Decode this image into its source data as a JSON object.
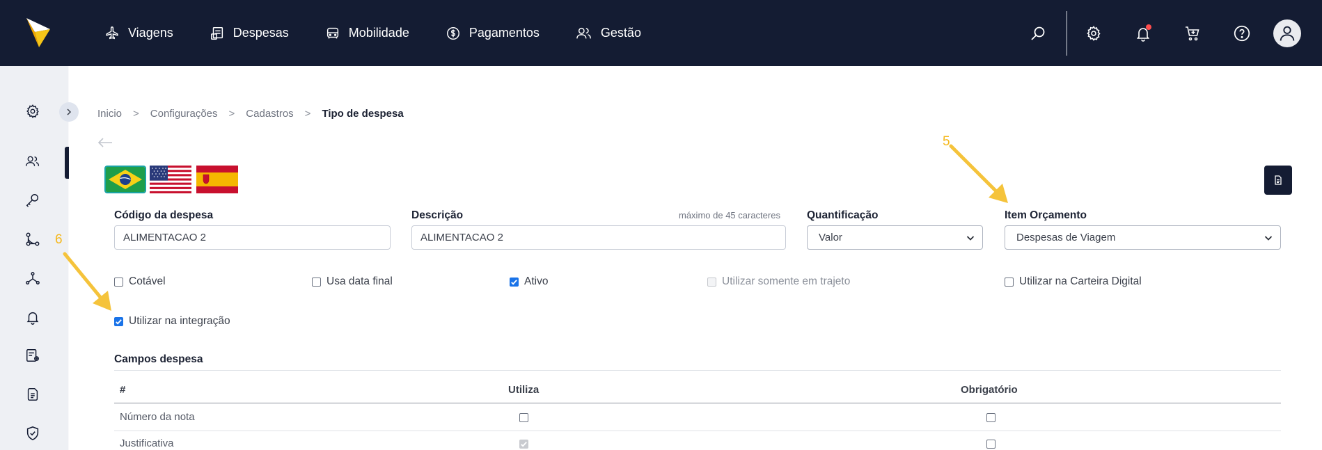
{
  "nav": {
    "items": [
      {
        "label": "Viagens",
        "icon": "airplane-icon"
      },
      {
        "label": "Despesas",
        "icon": "receipt-icon"
      },
      {
        "label": "Mobilidade",
        "icon": "car-icon"
      },
      {
        "label": "Pagamentos",
        "icon": "dollar-icon"
      },
      {
        "label": "Gestão",
        "icon": "users-icon"
      }
    ],
    "tools": [
      "search-icon",
      "gear-icon",
      "bell-icon",
      "cart-icon",
      "help-icon",
      "avatar-icon"
    ]
  },
  "rail": {
    "icons": [
      "gear-icon",
      "users-icon",
      "key-icon",
      "flow-icon",
      "hierarchy-icon",
      "bell-icon",
      "report-settings-icon",
      "document-icon",
      "shield-check-icon"
    ]
  },
  "breadcrumb": {
    "items": [
      "Inicio",
      "Configurações",
      "Cadastros"
    ],
    "current": "Tipo de despesa",
    "separator": ">"
  },
  "languages": [
    "brazil-flag",
    "usa-flag",
    "spain-flag"
  ],
  "form": {
    "codigo": {
      "label": "Código da despesa",
      "value": "ALIMENTACAO 2"
    },
    "descricao": {
      "label": "Descrição",
      "hint": "máximo de 45 caracteres",
      "value": "ALIMENTACAO 2"
    },
    "quantificacao": {
      "label": "Quantificação",
      "value": "Valor"
    },
    "item_orcamento": {
      "label": "Item Orçamento",
      "value": "Despesas de Viagem"
    },
    "checkboxes": {
      "cotavel": {
        "label": "Cotável",
        "checked": false
      },
      "usa_data_final": {
        "label": "Usa data final",
        "checked": false
      },
      "ativo": {
        "label": "Ativo",
        "checked": true
      },
      "trajeto": {
        "label": "Utilizar somente em trajeto",
        "checked": false,
        "disabled": true
      },
      "carteira": {
        "label": "Utilizar na Carteira Digital",
        "checked": false
      },
      "integracao": {
        "label": "Utilizar na integração",
        "checked": true
      }
    }
  },
  "campos": {
    "title": "Campos despesa",
    "headers": [
      "#",
      "Utiliza",
      "Obrigatório"
    ],
    "rows": [
      {
        "name": "Número da nota",
        "utiliza": false,
        "utiliza_disabled": false,
        "obrigatorio": false
      },
      {
        "name": "Justificativa",
        "utiliza": true,
        "utiliza_disabled": true,
        "obrigatorio": false
      }
    ]
  },
  "annotations": {
    "a5": "5",
    "a6": "6"
  },
  "colors": {
    "navbar": "#141c33",
    "accent": "#1a73e8",
    "annotation": "#f5b81c"
  }
}
